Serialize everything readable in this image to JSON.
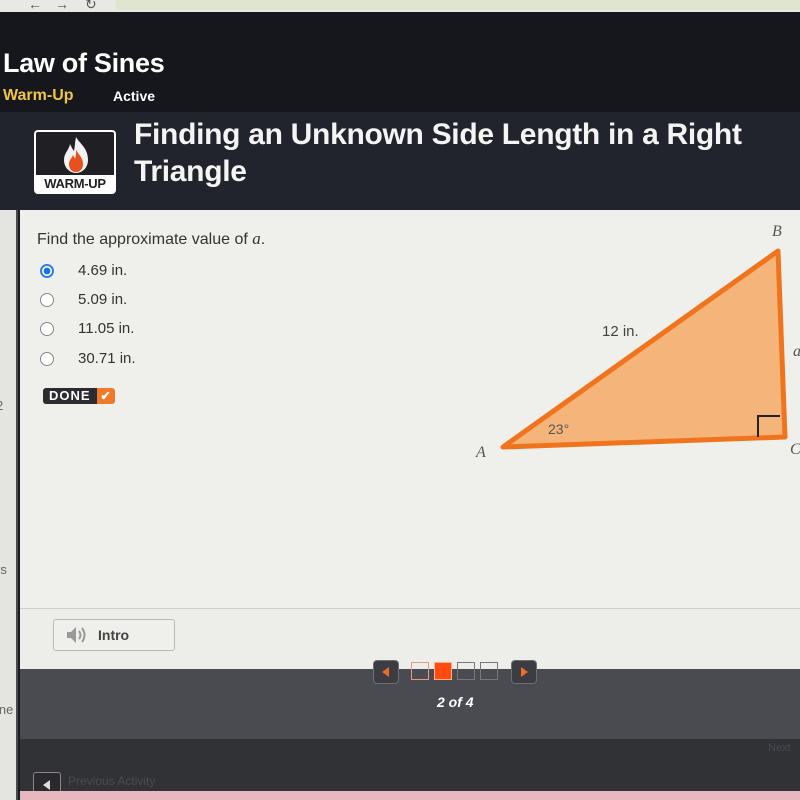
{
  "browser": {
    "back_icon": "arrow-left-icon",
    "forward_icon": "arrow-right-icon",
    "reload_icon": "reload-icon",
    "url": "file:///..."
  },
  "page": {
    "title": "Law of Sines",
    "section": "Warm-Up",
    "status": "Active"
  },
  "header": {
    "badge_label": "WARM-UP",
    "badge_icon": "flame-icon",
    "title": "Finding an Unknown Side Length in a Right Triangle"
  },
  "question": {
    "prompt_prefix": "Find the approximate value of ",
    "prompt_var": "a",
    "prompt_suffix": ".",
    "options": [
      {
        "label": "4.69 in.",
        "selected": true
      },
      {
        "label": "5.09 in.",
        "selected": false
      },
      {
        "label": "11.05 in.",
        "selected": false
      },
      {
        "label": "30.71 in.",
        "selected": false
      }
    ],
    "done_label": "DONE",
    "done_icon": "checkmark-icon"
  },
  "figure": {
    "vertices": {
      "A": "A",
      "B": "B",
      "C": "C"
    },
    "hypotenuse_label": "12 in.",
    "side_label": "a",
    "angle_label": "23°",
    "fill_color": "#f5b57a",
    "stroke_color": "#f0741e"
  },
  "intro": {
    "label": "Intro",
    "icon": "speaker-icon"
  },
  "pager": {
    "current": 2,
    "total": 4,
    "label": "2 of 4",
    "prev_icon": "chevron-left-icon",
    "next_icon": "chevron-right-icon",
    "accent": "#ff4a10"
  },
  "footer": {
    "prev_activity_label": "Previous Activity",
    "next_label": "Next"
  },
  "sidebar_fragments": [
    "2",
    "rs",
    "ine"
  ]
}
